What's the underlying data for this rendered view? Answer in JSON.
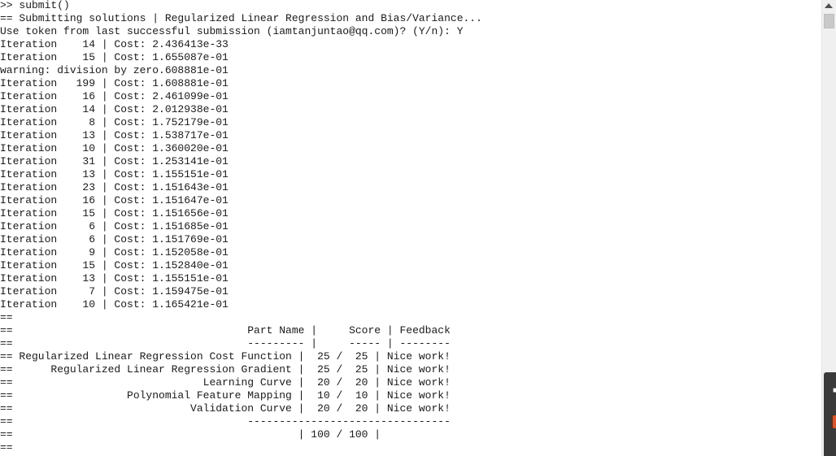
{
  "console": {
    "lines": [
      ">> submit()",
      "== Submitting solutions | Regularized Linear Regression and Bias/Variance...",
      "Use token from last successful submission (iamtanjuntao@qq.com)? (Y/n): Y",
      "Iteration    14 | Cost: 2.436413e-33",
      "Iteration    15 | Cost: 1.655087e-01",
      "warning: division by zero.608881e-01",
      "Iteration   199 | Cost: 1.608881e-01",
      "Iteration    16 | Cost: 2.461099e-01",
      "Iteration    14 | Cost: 2.012938e-01",
      "Iteration     8 | Cost: 1.752179e-01",
      "Iteration    13 | Cost: 1.538717e-01",
      "Iteration    10 | Cost: 1.360020e-01",
      "Iteration    31 | Cost: 1.253141e-01",
      "Iteration    13 | Cost: 1.155151e-01",
      "Iteration    23 | Cost: 1.151643e-01",
      "Iteration    16 | Cost: 1.151647e-01",
      "Iteration    15 | Cost: 1.151656e-01",
      "Iteration     6 | Cost: 1.151685e-01",
      "Iteration     6 | Cost: 1.151769e-01",
      "Iteration     9 | Cost: 1.152058e-01",
      "Iteration    15 | Cost: 1.152840e-01",
      "Iteration    13 | Cost: 1.155151e-01",
      "Iteration     7 | Cost: 1.159475e-01",
      "Iteration    10 | Cost: 1.165421e-01",
      "==",
      "==                                     Part Name |     Score | Feedback",
      "==                                     --------- |     ----- | --------",
      "== Regularized Linear Regression Cost Function |  25 /  25 | Nice work!",
      "==      Regularized Linear Regression Gradient |  25 /  25 | Nice work!",
      "==                              Learning Curve |  20 /  20 | Nice work!",
      "==                  Polynomial Feature Mapping |  10 /  10 | Nice work!",
      "==                            Validation Curve |  20 /  20 | Nice work!",
      "==                                     --------------------------------",
      "==                                             | 100 / 100 |",
      "=="
    ]
  },
  "scrollbar": {
    "up_arrow_icon": "triangle-up-icon"
  },
  "colors": {
    "text": "#1a1a1a",
    "background": "#ffffff",
    "scrollbar_track": "#f0f0f0",
    "scrollbar_thumb": "#c9c9c9",
    "side_tab": "#3a3a3a",
    "side_tab_accent": "#e8501f"
  }
}
